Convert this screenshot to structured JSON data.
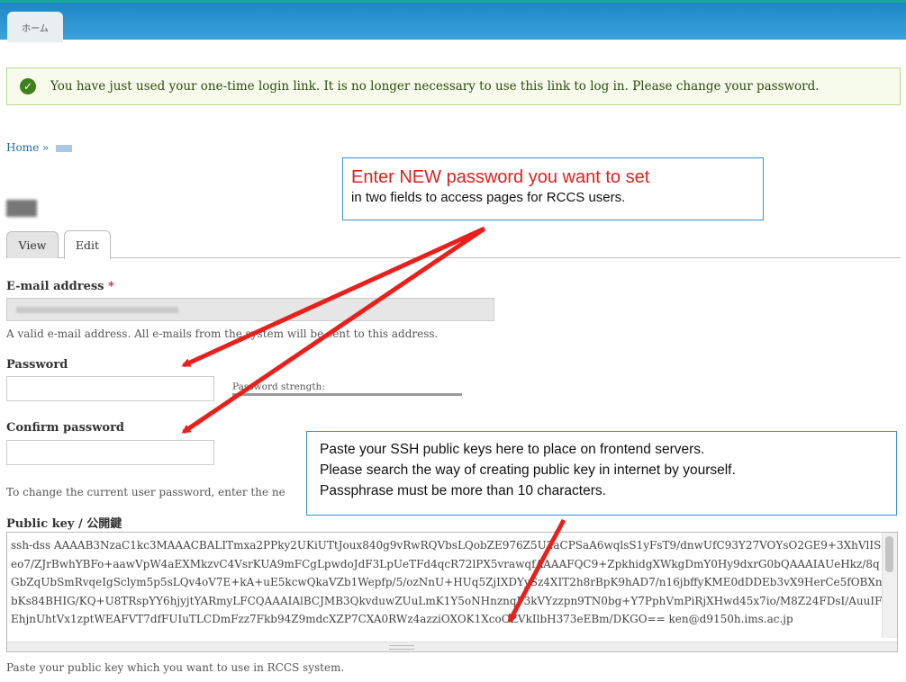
{
  "nav": {
    "home_tab": "ホーム"
  },
  "status": {
    "message": "You have just used your one-time login link. It is no longer necessary to use this link to log in. Please change your password."
  },
  "breadcrumb": {
    "home": "Home",
    "sep": "»"
  },
  "tabs": [
    {
      "label": "View"
    },
    {
      "label": "Edit"
    }
  ],
  "form": {
    "email_label": "E-mail address",
    "required_mark": "*",
    "email_desc": "A valid e-mail address. All e-mails from the system will be sent to this address.",
    "password_label": "Password",
    "strength_label": "Password strength:",
    "confirm_label": "Confirm password",
    "change_desc": "To change the current user password, enter the ne",
    "pubkey_label": "Public key / 公開鍵",
    "pubkey_value": "ssh-dss AAAAB3NzaC1kc3MAAACBALITmxa2PPky2UKiUTtJoux840g9vRwRQVbsLQobZE976Z5U2aCPSaA6wqlsS1yFsT9/dnwUfC93Y27VOYsO2GE9+3XhVlISeo7/ZJrBwhYBFo+aawVpW4aEXMkzvC4VsrKUA9mFCgLpwdoJdF3LpUeTFd4qcR72lPX5vrawqfAAAAFQC9+ZpkhidgXWkgDmY0Hy9dxrG0bQAAAIAUeHkz/8qGbZqUbSmRvqeIgSclym5p5sLQv4oV7E+kA+uE5kcwQkaVZb1Wepfp/5/ozNnU+HUq5ZjIXDYySz4XIT2h8rBpK9hAD7/n16jbffyKME0dDDEb3vX9HerCe5fOBXnbKs84BHIG/KQ+U8TRspYY6hjyjtYARmyLFCQAAAIAlBCJMB3QkvduwZUuLmK1Y5oNHnznqP3kVYzzpn9TN0bg+Y7PphVmPiRjXHwd45x7io/M8Z24FDsI/AuuIFEhjnUhtVx1zptWEAFVT7dfFUIuTLCDmFzz7Fkb94Z9mdcXZP7CXA0RWz4azziOXOK1XcoOZVkIlbH373eEBm/DKGO== ken@d9150h.ims.ac.jp",
    "pubkey_desc": "Paste your public key which you want to use in RCCS system."
  },
  "callout1": {
    "headline": "Enter NEW password you want to set",
    "sub": "in two fields to access pages for RCCS users."
  },
  "callout2": {
    "line1": "Paste your SSH public keys here to place on frontend servers.",
    "line2": "Please search the way of creating public key in internet by yourself.",
    "line3": "Passphrase must be more than 10 characters."
  },
  "colors": {
    "accent": "#1e86c6",
    "arrow": "#e8201c",
    "callout_border": "#3b8fd1"
  }
}
